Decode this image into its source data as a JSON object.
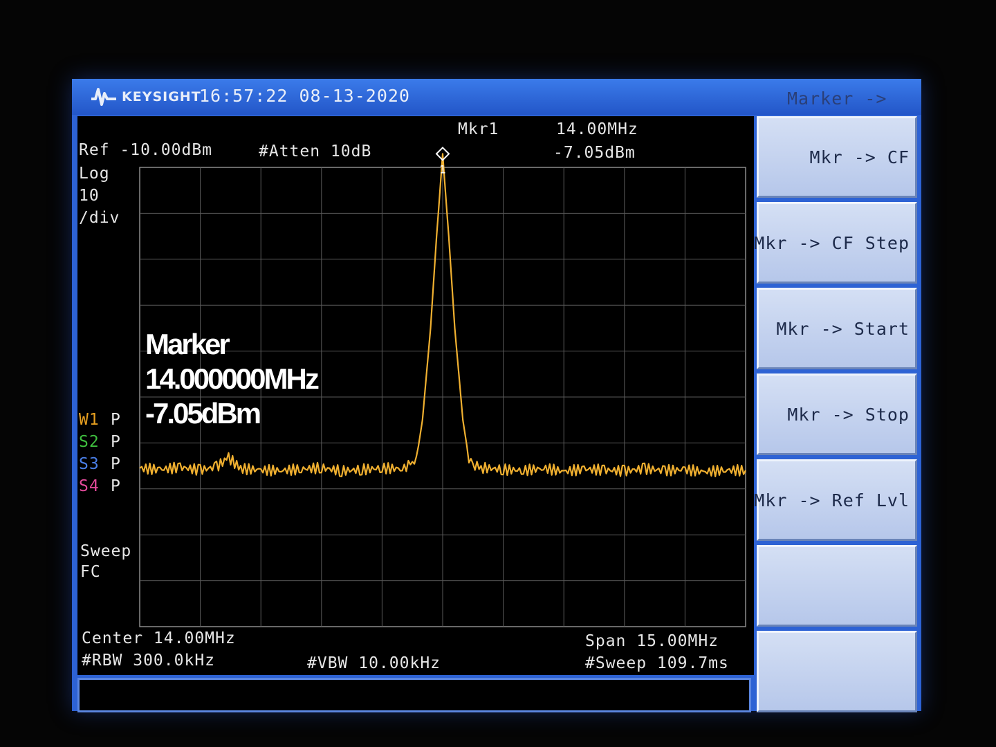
{
  "header": {
    "brand": "KEYSIGHT",
    "datetime": "16:57:22 08-13-2020",
    "softkey_menu_title": "Marker ->"
  },
  "settings": {
    "ref": "Ref -10.00dBm",
    "atten": "#Atten 10dB",
    "scale_type": "Log",
    "scale_value": "10",
    "scale_unit": "/div",
    "center": "Center 14.00MHz",
    "rbw": "#RBW 300.0kHz",
    "vbw": "#VBW 10.00kHz",
    "span": "Span 15.00MHz",
    "sweep_time": "#Sweep 109.7ms",
    "sweep_label": "Sweep",
    "sweep_mode": "FC"
  },
  "marker": {
    "label": "Mkr1",
    "freq": "14.00MHz",
    "amp": "-7.05dBm",
    "number": "1",
    "overlay_title": "Marker",
    "overlay_freq": "14.000000MHz",
    "overlay_amp": "-7.05dBm"
  },
  "traces": [
    {
      "id": "W1",
      "mode": "P",
      "color": "#e8a020"
    },
    {
      "id": "S2",
      "mode": "P",
      "color": "#3fbf3f"
    },
    {
      "id": "S3",
      "mode": "P",
      "color": "#4a7fe8"
    },
    {
      "id": "S4",
      "mode": "P",
      "color": "#e24a9a"
    }
  ],
  "softkeys": [
    {
      "label": "Mkr -> CF"
    },
    {
      "label": "Mkr -> CF Step"
    },
    {
      "label": "Mkr -> Start"
    },
    {
      "label": "Mkr -> Stop"
    },
    {
      "label": "Mkr -> Ref Lvl"
    },
    {
      "label": ""
    },
    {
      "label": ""
    }
  ],
  "chart_data": {
    "type": "line",
    "x_start_mhz": 6.5,
    "x_stop_mhz": 21.5,
    "y_ref_dbm": -10,
    "y_div_db": 10,
    "y_divisions": 10,
    "x_divisions": 10,
    "grid": true,
    "trace_color": "#f0b030",
    "series": [
      {
        "x": [
          6.5,
          7.0,
          7.5,
          8.0,
          8.4,
          8.7,
          9.0,
          9.5,
          10.0,
          10.5,
          11.0,
          11.5,
          12.0,
          12.5,
          13.0,
          13.2,
          13.35,
          13.5,
          13.7,
          13.85,
          14.0,
          14.15,
          14.3,
          14.5,
          14.65,
          14.8,
          15.0,
          15.5,
          16.0,
          16.5,
          17.0,
          17.5,
          18.0,
          18.5,
          19.0,
          19.5,
          20.0,
          20.5,
          21.0,
          21.5
        ],
        "y": [
          -75.5,
          -75.8,
          -75.3,
          -75.9,
          -75.2,
          -73.2,
          -75.6,
          -75.9,
          -76.0,
          -75.7,
          -75.4,
          -76.1,
          -75.8,
          -75.5,
          -75.6,
          -74.8,
          -73.5,
          -65.0,
          -45.0,
          -25.0,
          -7.05,
          -25.0,
          -45.0,
          -65.0,
          -73.5,
          -74.8,
          -75.4,
          -75.8,
          -76.0,
          -75.5,
          -76.2,
          -75.7,
          -75.9,
          -76.1,
          -75.6,
          -76.0,
          -75.8,
          -76.3,
          -75.9,
          -76.0
        ]
      }
    ]
  }
}
